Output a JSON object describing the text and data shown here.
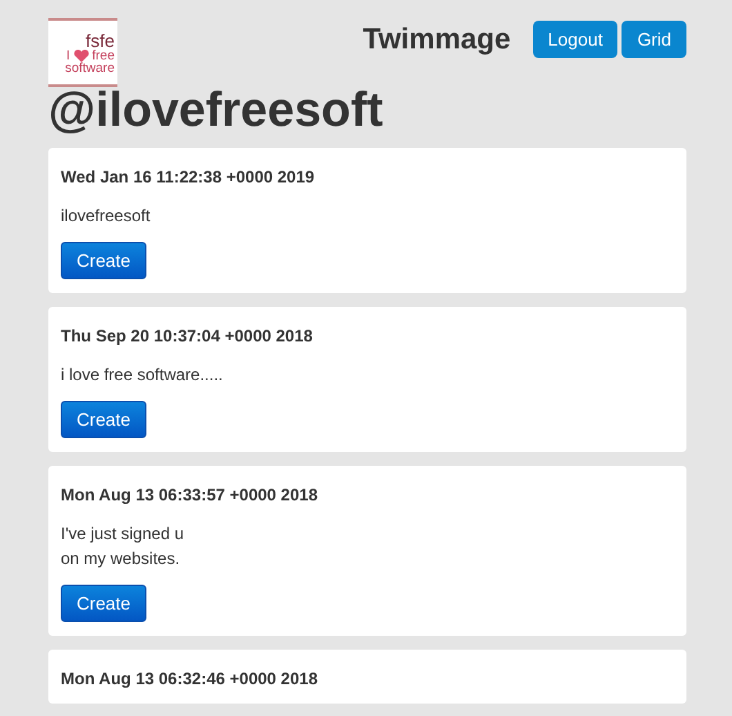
{
  "logo": {
    "lines": [
      "fsfe",
      "I",
      "free",
      "software"
    ]
  },
  "header": {
    "title": "Twimmage",
    "buttons": [
      "Logout",
      "Grid"
    ]
  },
  "handle": "@ilovefreesoft",
  "posts": [
    {
      "date": "Wed Jan 16 11:22:38 +0000 2019",
      "text": [
        "ilovefreesoft"
      ],
      "button": "Create"
    },
    {
      "date": "Thu Sep 20 10:37:04 +0000 2018",
      "text": [
        "i love free software....."
      ],
      "button": "Create"
    },
    {
      "date": "Mon Aug 13 06:33:57 +0000 2018",
      "text": [
        "I've just signed u",
        "on my websites."
      ],
      "button": "Create"
    },
    {
      "date": "Mon Aug 13 06:32:46 +0000 2018"
    }
  ]
}
